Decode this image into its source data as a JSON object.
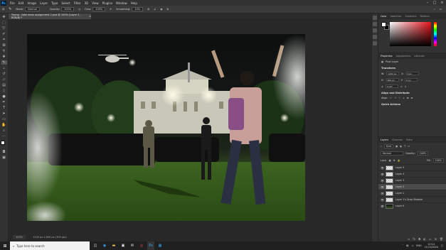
{
  "menubar": {
    "logo": "Ps",
    "items": [
      "File",
      "Edit",
      "Image",
      "Layer",
      "Type",
      "Select",
      "Filter",
      "3D",
      "View",
      "Plugins",
      "Window",
      "Help"
    ]
  },
  "options": {
    "mode_label": "Mode:",
    "mode_value": "Normal",
    "opacity_label": "Opacity:",
    "opacity_value": "100%",
    "flow_label": "Flow:",
    "flow_value": "100%",
    "smoothing_label": "Smoothing:",
    "smoothing_value": "10%"
  },
  "document": {
    "tab_title": "Trump - fake news assignment 2.psd @ 100% (Layer 2, RGB/8) *",
    "zoom": "100%",
    "doc_size": "1200 px x 800 px (300 ppi)"
  },
  "panels": {
    "color_tabs": [
      "Color",
      "Swatches",
      "Gradients",
      "Patterns"
    ],
    "properties_tabs": [
      "Properties",
      "Adjustments",
      "Libraries"
    ],
    "pixel_layer": "Pixel Layer",
    "transform_label": "Transform",
    "w_label": "W:",
    "w_value": "1200 px",
    "h_label": "H:",
    "h_value": "800 px",
    "x_label": "X:",
    "x_value": "0 px",
    "y_label": "Y:",
    "y_value": "0 px",
    "angle_value": "0.00°",
    "align_label": "Align and Distribute",
    "align_sub": "Align:",
    "quick_actions": "Quick Actions",
    "layers_tabs": [
      "Layers",
      "Channels",
      "Paths"
    ],
    "kind_label": "Kind",
    "blend_mode": "Normal",
    "opacity_label": "Opacity:",
    "opacity_value": "100%",
    "lock_label": "Lock:",
    "fill_label": "Fill:",
    "fill_value": "100%",
    "layers": [
      {
        "name": "Layer 5",
        "thumb": "trans"
      },
      {
        "name": "Layer 4",
        "thumb": "trans"
      },
      {
        "name": "Layer 3",
        "thumb": "trans"
      },
      {
        "name": "Layer 2",
        "thumb": "trans",
        "selected": true
      },
      {
        "name": "Layer 1",
        "thumb": "trans"
      },
      {
        "name": "Layer 1's Drop Shadow",
        "thumb": "trans"
      },
      {
        "name": "Layer 0",
        "thumb": "photo"
      }
    ]
  },
  "taskbar": {
    "search_placeholder": "Type here to search",
    "lang": "ENG",
    "time": "12:14",
    "date": "11/11/2020"
  }
}
